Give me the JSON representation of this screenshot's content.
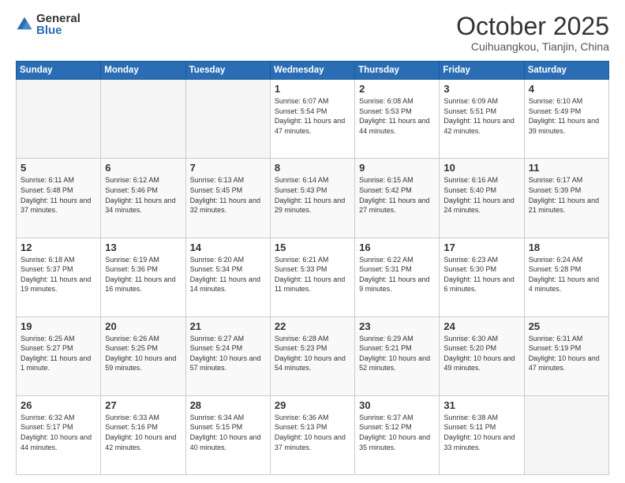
{
  "logo": {
    "general": "General",
    "blue": "Blue"
  },
  "header": {
    "month": "October 2025",
    "location": "Cuihuangkou, Tianjin, China"
  },
  "days_of_week": [
    "Sunday",
    "Monday",
    "Tuesday",
    "Wednesday",
    "Thursday",
    "Friday",
    "Saturday"
  ],
  "weeks": [
    [
      {
        "day": "",
        "info": ""
      },
      {
        "day": "",
        "info": ""
      },
      {
        "day": "",
        "info": ""
      },
      {
        "day": "1",
        "info": "Sunrise: 6:07 AM\nSunset: 5:54 PM\nDaylight: 11 hours\nand 47 minutes."
      },
      {
        "day": "2",
        "info": "Sunrise: 6:08 AM\nSunset: 5:53 PM\nDaylight: 11 hours\nand 44 minutes."
      },
      {
        "day": "3",
        "info": "Sunrise: 6:09 AM\nSunset: 5:51 PM\nDaylight: 11 hours\nand 42 minutes."
      },
      {
        "day": "4",
        "info": "Sunrise: 6:10 AM\nSunset: 5:49 PM\nDaylight: 11 hours\nand 39 minutes."
      }
    ],
    [
      {
        "day": "5",
        "info": "Sunrise: 6:11 AM\nSunset: 5:48 PM\nDaylight: 11 hours\nand 37 minutes."
      },
      {
        "day": "6",
        "info": "Sunrise: 6:12 AM\nSunset: 5:46 PM\nDaylight: 11 hours\nand 34 minutes."
      },
      {
        "day": "7",
        "info": "Sunrise: 6:13 AM\nSunset: 5:45 PM\nDaylight: 11 hours\nand 32 minutes."
      },
      {
        "day": "8",
        "info": "Sunrise: 6:14 AM\nSunset: 5:43 PM\nDaylight: 11 hours\nand 29 minutes."
      },
      {
        "day": "9",
        "info": "Sunrise: 6:15 AM\nSunset: 5:42 PM\nDaylight: 11 hours\nand 27 minutes."
      },
      {
        "day": "10",
        "info": "Sunrise: 6:16 AM\nSunset: 5:40 PM\nDaylight: 11 hours\nand 24 minutes."
      },
      {
        "day": "11",
        "info": "Sunrise: 6:17 AM\nSunset: 5:39 PM\nDaylight: 11 hours\nand 21 minutes."
      }
    ],
    [
      {
        "day": "12",
        "info": "Sunrise: 6:18 AM\nSunset: 5:37 PM\nDaylight: 11 hours\nand 19 minutes."
      },
      {
        "day": "13",
        "info": "Sunrise: 6:19 AM\nSunset: 5:36 PM\nDaylight: 11 hours\nand 16 minutes."
      },
      {
        "day": "14",
        "info": "Sunrise: 6:20 AM\nSunset: 5:34 PM\nDaylight: 11 hours\nand 14 minutes."
      },
      {
        "day": "15",
        "info": "Sunrise: 6:21 AM\nSunset: 5:33 PM\nDaylight: 11 hours\nand 11 minutes."
      },
      {
        "day": "16",
        "info": "Sunrise: 6:22 AM\nSunset: 5:31 PM\nDaylight: 11 hours\nand 9 minutes."
      },
      {
        "day": "17",
        "info": "Sunrise: 6:23 AM\nSunset: 5:30 PM\nDaylight: 11 hours\nand 6 minutes."
      },
      {
        "day": "18",
        "info": "Sunrise: 6:24 AM\nSunset: 5:28 PM\nDaylight: 11 hours\nand 4 minutes."
      }
    ],
    [
      {
        "day": "19",
        "info": "Sunrise: 6:25 AM\nSunset: 5:27 PM\nDaylight: 11 hours\nand 1 minute."
      },
      {
        "day": "20",
        "info": "Sunrise: 6:26 AM\nSunset: 5:25 PM\nDaylight: 10 hours\nand 59 minutes."
      },
      {
        "day": "21",
        "info": "Sunrise: 6:27 AM\nSunset: 5:24 PM\nDaylight: 10 hours\nand 57 minutes."
      },
      {
        "day": "22",
        "info": "Sunrise: 6:28 AM\nSunset: 5:23 PM\nDaylight: 10 hours\nand 54 minutes."
      },
      {
        "day": "23",
        "info": "Sunrise: 6:29 AM\nSunset: 5:21 PM\nDaylight: 10 hours\nand 52 minutes."
      },
      {
        "day": "24",
        "info": "Sunrise: 6:30 AM\nSunset: 5:20 PM\nDaylight: 10 hours\nand 49 minutes."
      },
      {
        "day": "25",
        "info": "Sunrise: 6:31 AM\nSunset: 5:19 PM\nDaylight: 10 hours\nand 47 minutes."
      }
    ],
    [
      {
        "day": "26",
        "info": "Sunrise: 6:32 AM\nSunset: 5:17 PM\nDaylight: 10 hours\nand 44 minutes."
      },
      {
        "day": "27",
        "info": "Sunrise: 6:33 AM\nSunset: 5:16 PM\nDaylight: 10 hours\nand 42 minutes."
      },
      {
        "day": "28",
        "info": "Sunrise: 6:34 AM\nSunset: 5:15 PM\nDaylight: 10 hours\nand 40 minutes."
      },
      {
        "day": "29",
        "info": "Sunrise: 6:36 AM\nSunset: 5:13 PM\nDaylight: 10 hours\nand 37 minutes."
      },
      {
        "day": "30",
        "info": "Sunrise: 6:37 AM\nSunset: 5:12 PM\nDaylight: 10 hours\nand 35 minutes."
      },
      {
        "day": "31",
        "info": "Sunrise: 6:38 AM\nSunset: 5:11 PM\nDaylight: 10 hours\nand 33 minutes."
      },
      {
        "day": "",
        "info": ""
      }
    ]
  ]
}
